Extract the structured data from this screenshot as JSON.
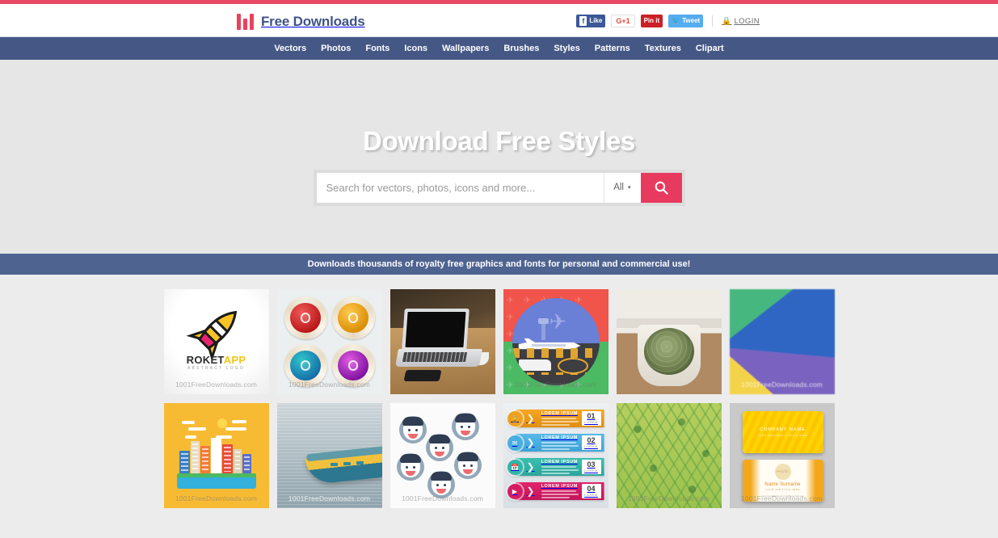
{
  "brand": {
    "name": "Free Downloads",
    "logo_icon": "bars-logo-icon"
  },
  "social": {
    "facebook_label": "Like",
    "facebook_glyph": "f",
    "gplus_label": "G+1",
    "pinterest_label": "Pin it",
    "twitter_label": "Tweet",
    "twitter_glyph": "✈",
    "login_label": "LOGIN",
    "login_icon": "lock-icon"
  },
  "nav": {
    "items": [
      {
        "label": "Vectors"
      },
      {
        "label": "Photos"
      },
      {
        "label": "Fonts"
      },
      {
        "label": "Icons"
      },
      {
        "label": "Wallpapers"
      },
      {
        "label": "Brushes"
      },
      {
        "label": "Styles"
      },
      {
        "label": "Patterns"
      },
      {
        "label": "Textures"
      },
      {
        "label": "Clipart"
      }
    ]
  },
  "hero": {
    "title": "Download Free Styles",
    "search_placeholder": "Search for vectors, photos, icons and more...",
    "search_value": "",
    "filter_selected": "All",
    "filter_caret": "▾",
    "search_button_icon": "search-icon"
  },
  "promo": {
    "text": "Downloads thousands of royalty free graphics and fonts for personal and commercial use!"
  },
  "watermark": "1001FreeDownloads.com",
  "gallery": {
    "row1": [
      {
        "name": "roketapp-logo",
        "title_1": "ROKET",
        "title_2": "APP",
        "subtitle": "ABSTRACT LOGO",
        "watermark": "1001FreeDownloads.com"
      },
      {
        "name": "cd-discs",
        "watermark": "1001FreeDownloads.com"
      },
      {
        "name": "laptop-desk-photo",
        "watermark": ""
      },
      {
        "name": "airport-aviation-illustration",
        "watermark": "1001FreeDownloads.com"
      },
      {
        "name": "cactus-pot-photo",
        "watermark": ""
      },
      {
        "name": "rainbow-swirl-abstract",
        "watermark": "1001FreeDownloads.com"
      }
    ],
    "row2": [
      {
        "name": "flat-city-illustration",
        "watermark": "1001FreeDownloads.com"
      },
      {
        "name": "boat-sea-photo",
        "watermark": "1001FreeDownloads.com"
      },
      {
        "name": "face-emoticons",
        "watermark": "1001FreeDownloads.com"
      },
      {
        "name": "infographic-banners",
        "watermark": ""
      },
      {
        "name": "green-leaf-pattern",
        "watermark": "1001FreeDownloads.com"
      },
      {
        "name": "business-card-mockup",
        "watermark": "1001FreeDownloads.com"
      }
    ]
  },
  "infographic": {
    "rows": [
      {
        "number": "01",
        "sub": "LOREM",
        "title": "LOREM IPSUM",
        "icon": "lock-icon"
      },
      {
        "number": "02",
        "sub": "LOREM",
        "title": "LOREM IPSUM",
        "icon": "mail-icon"
      },
      {
        "number": "03",
        "sub": "LOREM",
        "title": "LOREM IPSUM",
        "icon": "calendar-icon"
      },
      {
        "number": "04",
        "sub": "LOREM",
        "title": "LOREM IPSUM",
        "icon": "video-icon"
      }
    ]
  },
  "business_card": {
    "company": "COMPANY NAME",
    "company_sub": "YOUR BUSINESS SLOGAN HERE",
    "photo_label": "PHOTO",
    "person": "Name Surname",
    "job": "YOUR JOB TITLE HERE",
    "contact": "www.yourwebsite.com\nmail@yourmail.com"
  },
  "colors": {
    "accent_red": "#e83a5f",
    "top_strip": "#e84a63",
    "nav_blue": "#455885",
    "promo_blue": "#4f6391",
    "brand_text": "#3f5387",
    "page_bg": "#ececec",
    "hero_bg": "#e6e6e6"
  }
}
